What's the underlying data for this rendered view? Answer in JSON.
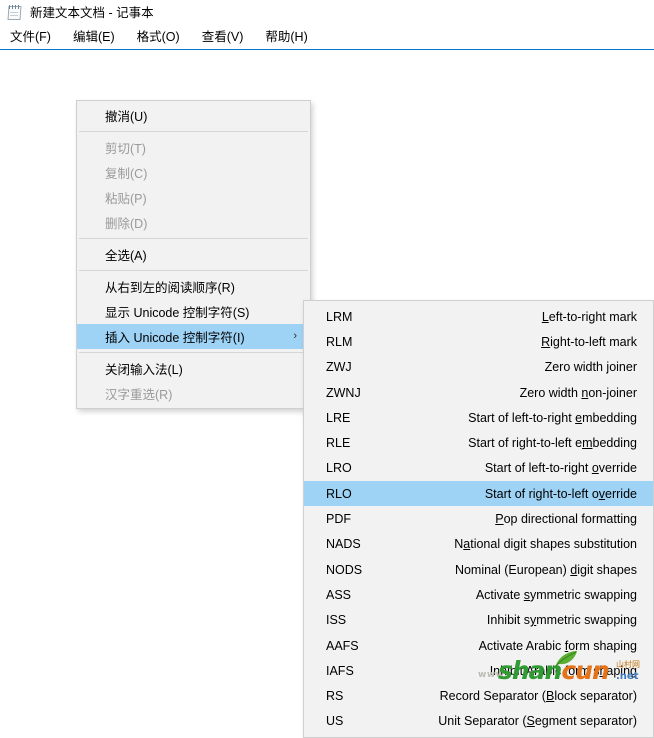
{
  "window": {
    "title": "新建文本文档 - 记事本",
    "icon": "notepad-icon"
  },
  "menubar": {
    "items": [
      {
        "label": "文件(F)"
      },
      {
        "label": "编辑(E)"
      },
      {
        "label": "格式(O)"
      },
      {
        "label": "查看(V)"
      },
      {
        "label": "帮助(H)"
      }
    ]
  },
  "context_menu": {
    "items": [
      {
        "label": "撤消(U)",
        "type": "item",
        "enabled": true,
        "selected": false,
        "submenu": false
      },
      {
        "type": "separator"
      },
      {
        "label": "剪切(T)",
        "type": "item",
        "enabled": false,
        "selected": false,
        "submenu": false
      },
      {
        "label": "复制(C)",
        "type": "item",
        "enabled": false,
        "selected": false,
        "submenu": false
      },
      {
        "label": "粘贴(P)",
        "type": "item",
        "enabled": false,
        "selected": false,
        "submenu": false
      },
      {
        "label": "删除(D)",
        "type": "item",
        "enabled": false,
        "selected": false,
        "submenu": false
      },
      {
        "type": "separator"
      },
      {
        "label": "全选(A)",
        "type": "item",
        "enabled": true,
        "selected": false,
        "submenu": false
      },
      {
        "type": "separator"
      },
      {
        "label": "从右到左的阅读顺序(R)",
        "type": "item",
        "enabled": true,
        "selected": false,
        "submenu": false
      },
      {
        "label": "显示 Unicode 控制字符(S)",
        "type": "item",
        "enabled": true,
        "selected": false,
        "submenu": false
      },
      {
        "label": "插入 Unicode 控制字符(I)",
        "type": "item",
        "enabled": true,
        "selected": true,
        "submenu": true,
        "arrow": "›"
      },
      {
        "type": "separator"
      },
      {
        "label": "关闭输入法(L)",
        "type": "item",
        "enabled": true,
        "selected": false,
        "submenu": false
      },
      {
        "label": "汉字重选(R)",
        "type": "item",
        "enabled": false,
        "selected": false,
        "submenu": false
      }
    ]
  },
  "submenu": {
    "items": [
      {
        "code": "LRM",
        "desc_pre": "",
        "desc_accel": "L",
        "desc_post": "eft-to-right mark",
        "selected": false
      },
      {
        "code": "RLM",
        "desc_pre": "",
        "desc_accel": "R",
        "desc_post": "ight-to-left mark",
        "selected": false
      },
      {
        "code": "ZWJ",
        "desc_pre": "Zero width ",
        "desc_accel": "j",
        "desc_post": "oiner",
        "selected": false
      },
      {
        "code": "ZWNJ",
        "desc_pre": "Zero width ",
        "desc_accel": "n",
        "desc_post": "on-joiner",
        "selected": false
      },
      {
        "code": "LRE",
        "desc_pre": "Start of left-to-right ",
        "desc_accel": "e",
        "desc_post": "mbedding",
        "selected": false
      },
      {
        "code": "RLE",
        "desc_pre": "Start of right-to-left e",
        "desc_accel": "m",
        "desc_post": "bedding",
        "selected": false
      },
      {
        "code": "LRO",
        "desc_pre": "Start of left-to-right ",
        "desc_accel": "o",
        "desc_post": "verride",
        "selected": false
      },
      {
        "code": "RLO",
        "desc_pre": "Start of right-to-left o",
        "desc_accel": "v",
        "desc_post": "erride",
        "selected": true
      },
      {
        "code": "PDF",
        "desc_pre": "",
        "desc_accel": "P",
        "desc_post": "op directional formatting",
        "selected": false
      },
      {
        "code": "NADS",
        "desc_pre": "N",
        "desc_accel": "a",
        "desc_post": "tional digit shapes substitution",
        "selected": false
      },
      {
        "code": "NODS",
        "desc_pre": "Nominal (European) ",
        "desc_accel": "d",
        "desc_post": "igit shapes",
        "selected": false
      },
      {
        "code": "ASS",
        "desc_pre": "Activate ",
        "desc_accel": "s",
        "desc_post": "ymmetric swapping",
        "selected": false
      },
      {
        "code": "ISS",
        "desc_pre": "Inhibit s",
        "desc_accel": "y",
        "desc_post": "mmetric swapping",
        "selected": false
      },
      {
        "code": "AAFS",
        "desc_pre": "Activate Arabic ",
        "desc_accel": "f",
        "desc_post": "orm shaping",
        "selected": false
      },
      {
        "code": "IAFS",
        "desc_pre": "Inhibit Arabic form s",
        "desc_accel": "h",
        "desc_post": "aping",
        "selected": false
      },
      {
        "code": "RS",
        "desc_pre": "Record Separator (",
        "desc_accel": "B",
        "desc_post": "lock separator)",
        "selected": false
      },
      {
        "code": "US",
        "desc_pre": "Unit Separator (",
        "desc_accel": "S",
        "desc_post": "egment separator)",
        "selected": false
      }
    ]
  },
  "watermark": {
    "www": "www.",
    "part_green": "shan",
    "part_orange": "cun",
    "cn_text": "山村网",
    "net": ".net"
  },
  "colors": {
    "highlight": "#9ed3f5",
    "menu_bg": "#f2f2f2",
    "menu_border": "#cfcfcf",
    "disabled_text": "#9a9a9a",
    "accent_line": "#0078d7"
  }
}
